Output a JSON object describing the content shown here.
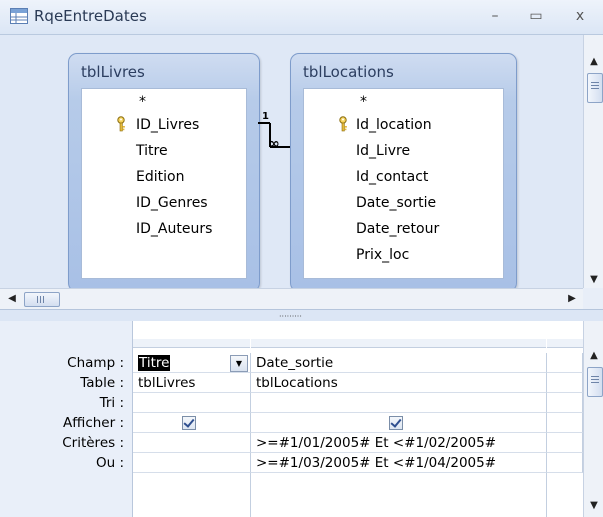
{
  "window": {
    "title": "RqeEntreDates",
    "min_glyph": "–",
    "max_glyph": "▭",
    "close_glyph": "x"
  },
  "tables": [
    {
      "name": "tblLivres",
      "fields": [
        "*",
        "ID_Livres",
        "Titre",
        "Edition",
        "ID_Genres",
        "ID_Auteurs"
      ],
      "key_field": "ID_Livres"
    },
    {
      "name": "tblLocations",
      "fields": [
        "*",
        "Id_location",
        "Id_Livre",
        "Id_contact",
        "Date_sortie",
        "Date_retour",
        "Prix_loc"
      ],
      "key_field": "Id_location"
    }
  ],
  "relationship": {
    "one_label": "1",
    "many_label": "∞"
  },
  "grid": {
    "row_labels": [
      "Champ :",
      "Table :",
      "Tri :",
      "Afficher :",
      "Critères :",
      "Ou :"
    ],
    "columns": [
      {
        "champ": "Titre",
        "table": "tblLivres",
        "tri": "",
        "afficher": true,
        "criteres": "",
        "ou": ""
      },
      {
        "champ": "Date_sortie",
        "table": "tblLocations",
        "tri": "",
        "afficher": true,
        "criteres": ">=#1/01/2005# Et <#1/02/2005#",
        "ou": ">=#1/03/2005# Et <#1/04/2005#"
      }
    ]
  },
  "scrollbar": {
    "up": "▲",
    "down": "▼",
    "left": "◀",
    "right": "▶"
  },
  "splitter_grip": "·········"
}
